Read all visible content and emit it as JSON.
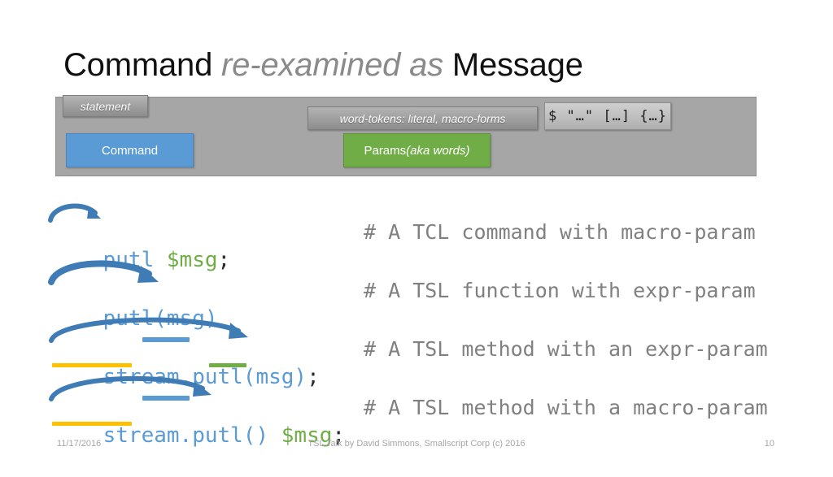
{
  "slide": {
    "title_part_1": "Command ",
    "title_part_2": "re-examined as",
    "title_part_3": " Message"
  },
  "diagram": {
    "statement_label": "statement",
    "word_tokens_label": "word-tokens: literal, macro-forms",
    "token_forms_label": "$  \"…\"  […]  {…}",
    "command_box_label": "Command",
    "params_box_label_main": "Params ",
    "params_box_label_em": "(aka words)",
    "colors": {
      "band": "#a6a6a6",
      "command": "#5b9bd5",
      "params": "#70ad47",
      "tag": "#9e9e9e"
    }
  },
  "code_rows": [
    {
      "code_blue_1": "putl ",
      "code_green": "$msg",
      "code_dark": ";",
      "comment": "# A TCL command with macro-param"
    },
    {
      "code_blue_1": "putl(msg)",
      "code_green": "",
      "code_dark": "",
      "comment": "# A TSL function with expr-param"
    },
    {
      "code_blue_1": "stream.putl(msg)",
      "code_green": "",
      "code_dark": ";",
      "comment": "# A TSL method with an expr-param"
    },
    {
      "code_blue_1": "stream.putl() ",
      "code_green": "$msg",
      "code_dark": ";",
      "comment": "# A TSL method with a macro-param"
    }
  ],
  "footer": {
    "date": "11/17/2016",
    "center": "TSL Talk by David Simmons, Smallscript Corp (c) 2016",
    "page": "10"
  }
}
